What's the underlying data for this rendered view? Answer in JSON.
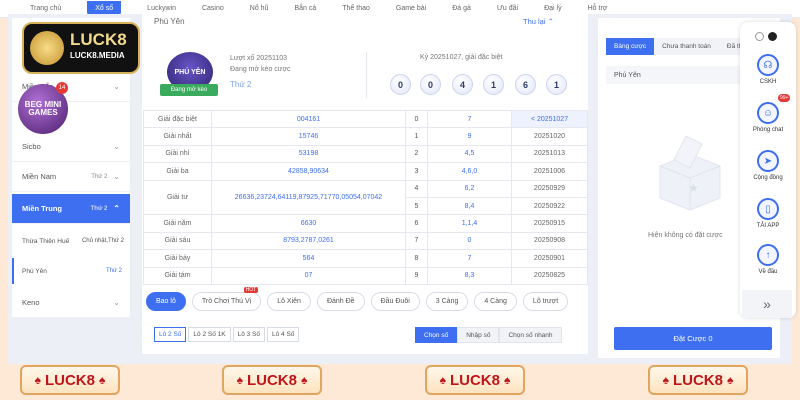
{
  "topnav": [
    "Trang chủ",
    "Xổ số",
    "Luckywin",
    "Casino",
    "Nổ hũ",
    "Bắn cá",
    "Thể thao",
    "Game bài",
    "Đá gà",
    "Ưu đãi",
    "Đại lý",
    "Hỗ trợ"
  ],
  "topnav_active": 1,
  "logo": {
    "line1": "LUCK8",
    "line2": "LUCK8.MEDIA"
  },
  "game_badge": {
    "text": "BEG MINI GAMES",
    "count": "14"
  },
  "sidebar": {
    "items": [
      {
        "label": "Miền Bắc",
        "sub": ""
      },
      {
        "label": "Sicbo",
        "sub": ""
      },
      {
        "label": "Miền Nam",
        "sub": "Thứ 2"
      },
      {
        "label": "Miền Trung",
        "sub": "Thứ 2"
      }
    ],
    "subitems": [
      {
        "label": "Thừa Thiên Huế",
        "day": "Chủ nhật,Thứ 2"
      },
      {
        "label": "Phú Yên",
        "day": "Thứ 2"
      }
    ],
    "last": {
      "label": "Keno"
    }
  },
  "lottery": {
    "title": "Phú Yên",
    "results_link": "Thu lại",
    "logo_text": "PHÚ YÊN",
    "status": "Đang mở kèo",
    "draw": "Lượt xổ 20251103",
    "draw_status": "Đang mở kèo cược",
    "day": "Thứ 2",
    "prev_title": "Kỳ 20251027, giải đặc biệt",
    "balls": [
      "0",
      "0",
      "4",
      "1",
      "6",
      "1"
    ]
  },
  "results": [
    {
      "label": "Giải đặc biệt",
      "nums": "004161",
      "digit": "0",
      "tail": "7",
      "period": "< 20251027"
    },
    {
      "label": "Giải nhất",
      "nums": "15746",
      "digit": "1",
      "tail": "9",
      "period": "20251020"
    },
    {
      "label": "Giải nhì",
      "nums": "53198",
      "digit": "2",
      "tail": "4,5",
      "period": "20251013"
    },
    {
      "label": "Giải ba",
      "nums": "42858,90634",
      "digit": "3",
      "tail": "4,6,0",
      "period": "20251006"
    },
    {
      "label": "Giải tư",
      "nums": "26636,23724,64119,87925,71770,05054,07042",
      "digit": "4",
      "tail": "6,2",
      "period": "20250929"
    },
    {
      "label": "",
      "nums": "",
      "digit": "5",
      "tail": "8,4",
      "period": "20250922"
    },
    {
      "label": "Giải năm",
      "nums": "6630",
      "digit": "6",
      "tail": "1,1,4",
      "period": "20250915"
    },
    {
      "label": "Giải sáu",
      "nums": "8793,2787,0261",
      "digit": "7",
      "tail": "0",
      "period": "20250908"
    },
    {
      "label": "Giải bảy",
      "nums": "564",
      "digit": "8",
      "tail": "7",
      "period": "20250901"
    },
    {
      "label": "Giải tám",
      "nums": "07",
      "digit": "9",
      "tail": "8,3",
      "period": "20250825"
    }
  ],
  "bet_tabs": [
    {
      "label": "Bao lô",
      "hot": ""
    },
    {
      "label": "Trò Chơi Thú Vị",
      "hot": "HOT"
    },
    {
      "label": "Lô Xiên",
      "hot": ""
    },
    {
      "label": "Đánh Đề",
      "hot": ""
    },
    {
      "label": "Đầu Đuôi",
      "hot": ""
    },
    {
      "label": "3 Càng",
      "hot": ""
    },
    {
      "label": "4 Càng",
      "hot": ""
    },
    {
      "label": "Lô trượt",
      "hot": ""
    }
  ],
  "sub_tabs": [
    "Lô 2 Số",
    "Lô 2 Số 1K",
    "Lô 3 Số",
    "Lô 4 Số"
  ],
  "modes": [
    "Chọn số",
    "Nhập số",
    "Chọn số nhanh"
  ],
  "right": {
    "tabs": [
      "Bảng cược",
      "Chưa thanh toán",
      "Đã thanh toán"
    ],
    "row_label": "Phú Yên",
    "row_value": "2",
    "empty": "Hiện không có đặt cược",
    "bet_button": "Đặt Cược 0"
  },
  "rail": [
    {
      "label": "CSKH",
      "icon": "headset-icon"
    },
    {
      "label": "Phòng chat",
      "icon": "chat-icon",
      "badge": "99+"
    },
    {
      "label": "Cộng đồng",
      "icon": "telegram-icon"
    },
    {
      "label": "TẢI APP",
      "icon": "phone-icon"
    },
    {
      "label": "Về đầu",
      "icon": "arrow-up-icon"
    }
  ],
  "bottom_brand": "LUCK8",
  "colors": {
    "accent": "#3d6ff0",
    "green": "#3aab5c",
    "brand_red": "#c0151a"
  }
}
